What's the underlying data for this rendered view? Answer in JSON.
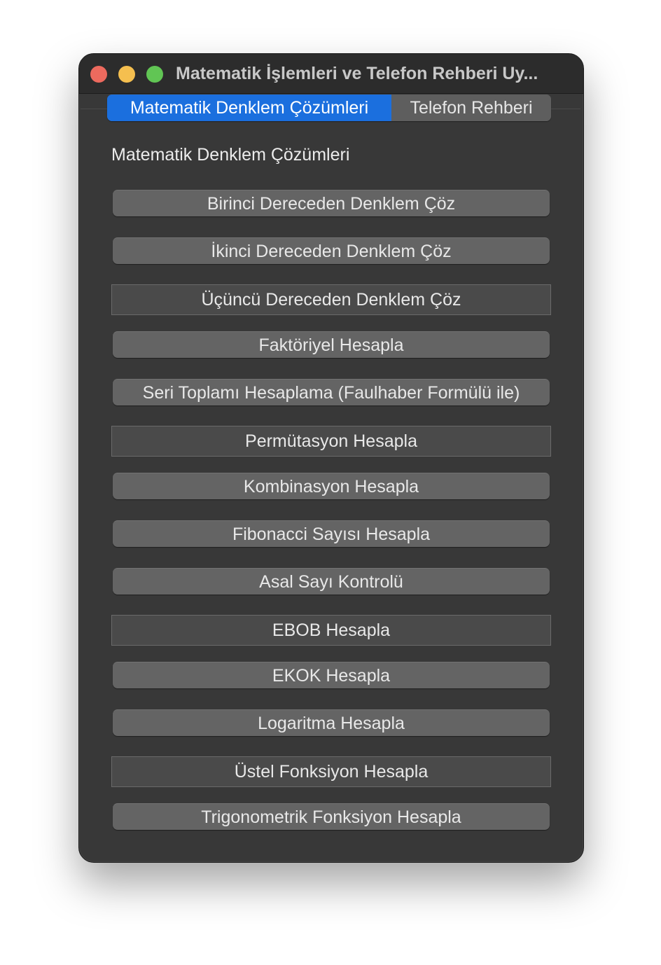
{
  "window": {
    "title": "Matematik İşlemleri ve Telefon Rehberi Uy..."
  },
  "tabs": [
    {
      "label": "Matematik Denklem Çözümleri",
      "active": true
    },
    {
      "label": "Telefon Rehberi",
      "active": false
    }
  ],
  "main": {
    "section_label": "Matematik Denklem Çözümleri",
    "buttons": [
      {
        "label": "Birinci Dereceden Denklem Çöz",
        "style": "rounded"
      },
      {
        "label": "İkinci Dereceden Denklem Çöz",
        "style": "rounded"
      },
      {
        "label": "Üçüncü Dereceden Denklem Çöz",
        "style": "square"
      },
      {
        "label": "Faktöriyel Hesapla",
        "style": "rounded"
      },
      {
        "label": "Seri Toplamı Hesaplama (Faulhaber Formülü ile)",
        "style": "rounded"
      },
      {
        "label": "Permütasyon Hesapla",
        "style": "square"
      },
      {
        "label": "Kombinasyon Hesapla",
        "style": "rounded"
      },
      {
        "label": "Fibonacci Sayısı Hesapla",
        "style": "rounded"
      },
      {
        "label": "Asal Sayı Kontrolü",
        "style": "rounded"
      },
      {
        "label": "EBOB Hesapla",
        "style": "square"
      },
      {
        "label": "EKOK Hesapla",
        "style": "rounded"
      },
      {
        "label": "Logaritma Hesapla",
        "style": "rounded"
      },
      {
        "label": "Üstel Fonksiyon Hesapla",
        "style": "square"
      },
      {
        "label": "Trigonometrik Fonksiyon Hesapla",
        "style": "rounded"
      }
    ]
  },
  "colors": {
    "accent": "#1b6fde",
    "window_bg": "#383838",
    "close": "#ed6a5e",
    "minimize": "#f5bf4f",
    "maximize": "#61c554"
  }
}
